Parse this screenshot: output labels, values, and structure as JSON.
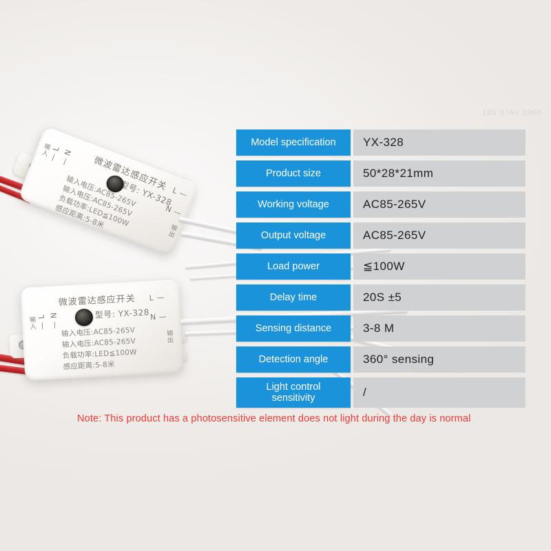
{
  "watermark": "180 0760 3960",
  "spec_table": {
    "rows": [
      {
        "key": "Model specification",
        "value": "YX-328"
      },
      {
        "key": "Product size",
        "value": "50*28*21mm"
      },
      {
        "key": "Working voltage",
        "value": "AC85-265V"
      },
      {
        "key": "Output voltage",
        "value": "AC85-265V"
      },
      {
        "key": "Load power",
        "value": "≦100W"
      },
      {
        "key": "Delay time",
        "value": "20S ±5"
      },
      {
        "key": "Sensing distance",
        "value": "3-8 M"
      },
      {
        "key": "Detection angle",
        "value": "360° sensing"
      },
      {
        "key_line1": "Light control",
        "key_line2": "sensitivity",
        "value": "/"
      }
    ]
  },
  "note": "Note: This product has a photosensitive element does not light during the day is normal",
  "device_label": {
    "title": "微波雷达感应开关",
    "model": "型号: YX-328",
    "spec_line1": "输入电压:AC85-265V",
    "spec_line2": "输入电压:AC85-265V",
    "spec_line3": "负载功率:LED≦100W",
    "spec_line4": "感应距离:5-8米",
    "terminal_l": "L —",
    "terminal_n": "N —",
    "terminal_in_l": "— L",
    "terminal_in_n": "— N",
    "input_label": "输入",
    "output_label": "输出"
  },
  "colors": {
    "accent_blue": "#1a93db",
    "value_gray": "#cfd1d2",
    "note_red": "#ef3a36",
    "wire_red": "#c8282c",
    "background": "#efecea"
  }
}
